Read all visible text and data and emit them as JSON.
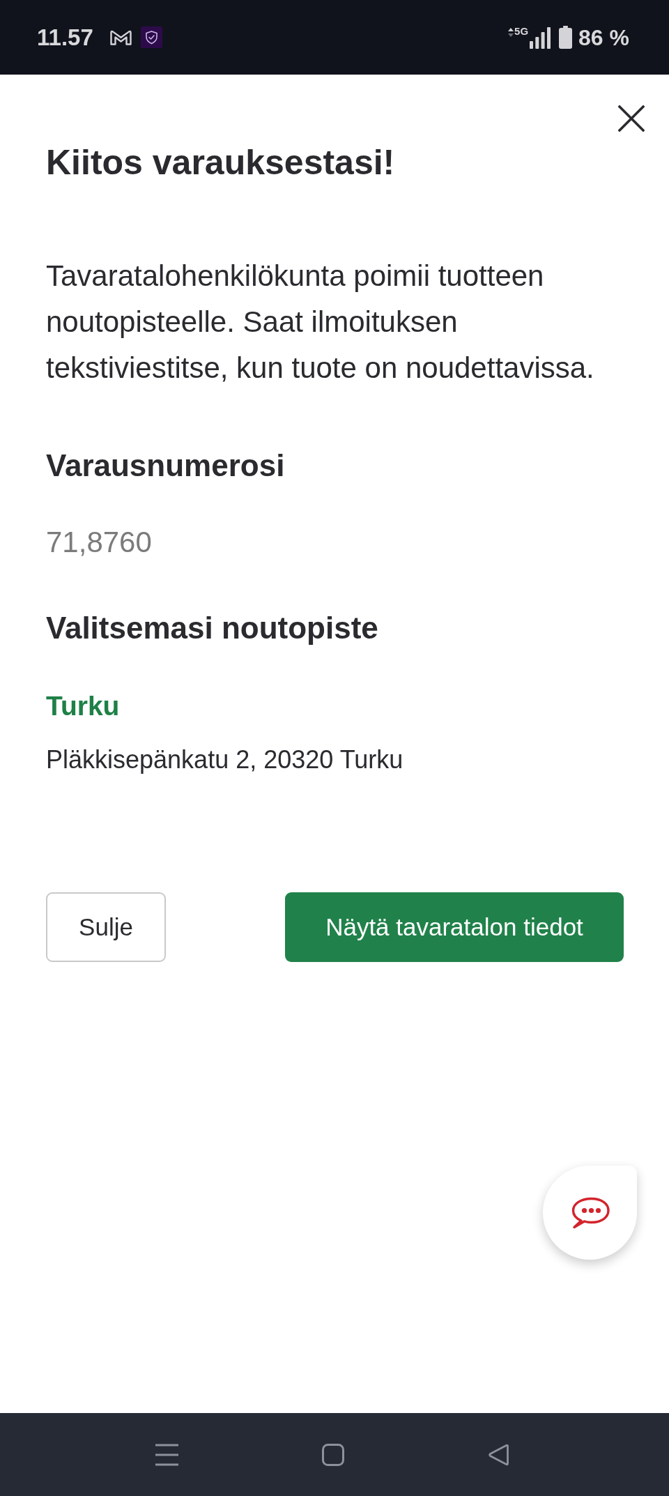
{
  "status_bar": {
    "time": "11.57",
    "network": "5G",
    "battery": "86 %"
  },
  "dialog": {
    "title": "Kiitos varauksestasi!",
    "message": "Tavaratalohenkilökunta poimii tuotteen noutopisteelle. Saat ilmoituksen tekstiviestitse, kun tuote on noudettavissa.",
    "reservation": {
      "heading": "Varausnumerosi",
      "number": "71,8760"
    },
    "pickup": {
      "heading": "Valitsemasi noutopiste",
      "store": "Turku",
      "address": "Pläkkisepänkatu 2, 20320 Turku"
    },
    "buttons": [
      {
        "label": "Sulje",
        "kind": "secondary"
      },
      {
        "label": "Näytä tavaratalon tiedot",
        "kind": "primary"
      }
    ]
  }
}
